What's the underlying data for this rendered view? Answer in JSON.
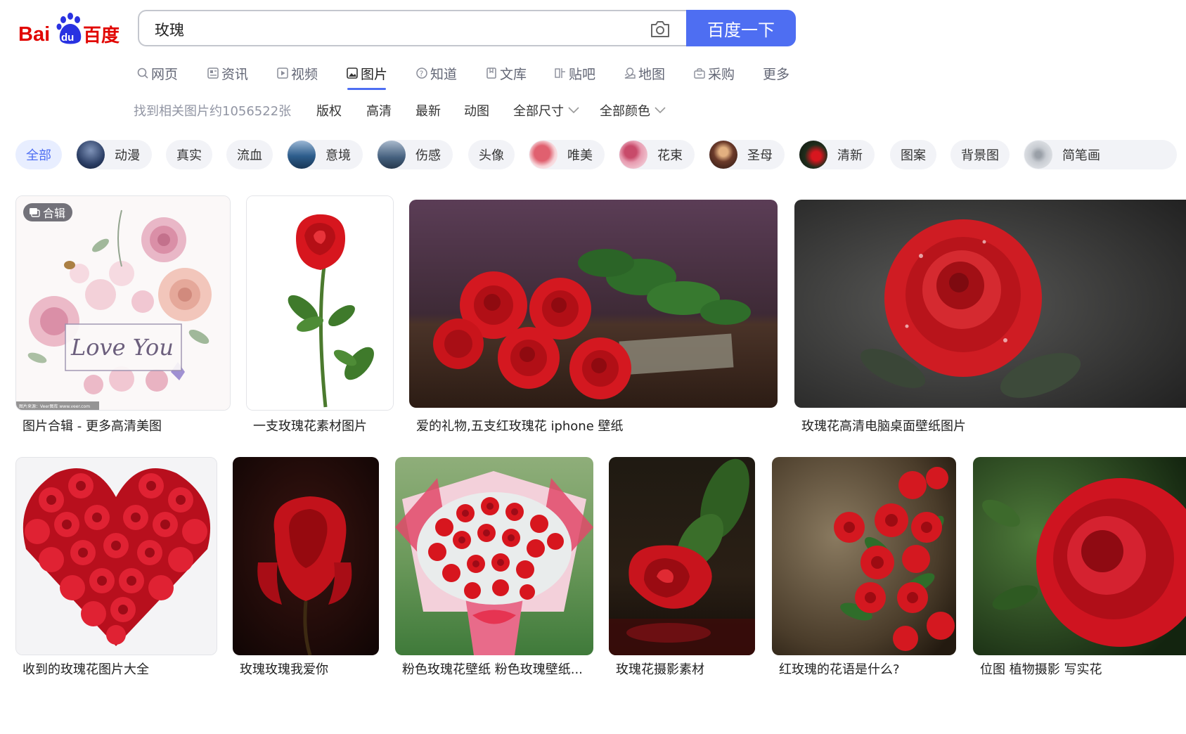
{
  "logo": {
    "text_left": "Bai",
    "text_du": "du",
    "text_cn": "百度"
  },
  "search": {
    "query": "玫瑰",
    "button_label": "百度一下"
  },
  "tabs": [
    {
      "label": "网页",
      "icon": "search-icon"
    },
    {
      "label": "资讯",
      "icon": "news-icon"
    },
    {
      "label": "视频",
      "icon": "video-icon"
    },
    {
      "label": "图片",
      "icon": "image-icon",
      "active": true
    },
    {
      "label": "知道",
      "icon": "question-icon"
    },
    {
      "label": "文库",
      "icon": "library-icon"
    },
    {
      "label": "贴吧",
      "icon": "tieba-icon"
    },
    {
      "label": "地图",
      "icon": "map-icon"
    },
    {
      "label": "采购",
      "icon": "shopping-icon"
    },
    {
      "label": "更多"
    }
  ],
  "filters": {
    "result_count": "找到相关图片约1056522张",
    "copyright": "版权",
    "hd": "高清",
    "latest": "最新",
    "animated": "动图",
    "size": "全部尺寸",
    "color": "全部颜色"
  },
  "chips": [
    {
      "label": "全部",
      "active": true
    },
    {
      "label": "动漫",
      "thumb_color": "#2c3f66"
    },
    {
      "label": "真实"
    },
    {
      "label": "流血"
    },
    {
      "label": "意境",
      "thumb_color": "#2d5d8c"
    },
    {
      "label": "伤感",
      "thumb_color": "#45607e"
    },
    {
      "label": "头像"
    },
    {
      "label": "唯美",
      "thumb_color": "#e0606f"
    },
    {
      "label": "花束",
      "thumb_color": "#c84a6a"
    },
    {
      "label": "圣母",
      "thumb_color": "#6b3a2a"
    },
    {
      "label": "清新",
      "thumb_color": "#1f2d1c"
    },
    {
      "label": "图案"
    },
    {
      "label": "背景图"
    },
    {
      "label": "简笔画",
      "thumb_color": "#c8ccd2"
    }
  ],
  "cards": {
    "row1": [
      {
        "caption": "图片合辑 - 更多高清美图",
        "badge": "合辑",
        "watermark": "图片来源：Veer图库 www.veer.com",
        "artwork_text": "Love You"
      },
      {
        "caption": "一支玫瑰花素材图片"
      },
      {
        "caption": "爱的礼物,五支红玫瑰花 iphone 壁纸"
      },
      {
        "caption": "玫瑰花高清电脑桌面壁纸图片"
      }
    ],
    "row2": [
      {
        "caption": "收到的玫瑰花图片大全"
      },
      {
        "caption": "玫瑰玫瑰我爱你"
      },
      {
        "caption": "粉色玫瑰花壁纸 粉色玫瑰壁纸..."
      },
      {
        "caption": "玫瑰花摄影素材"
      },
      {
        "caption": "红玫瑰的花语是什么?"
      },
      {
        "caption": "位图 植物摄影 写实花"
      }
    ]
  },
  "colors": {
    "brand_blue": "#4e6ef2",
    "baidu_red": "#e10602",
    "baidu_blue": "#2932e1"
  }
}
